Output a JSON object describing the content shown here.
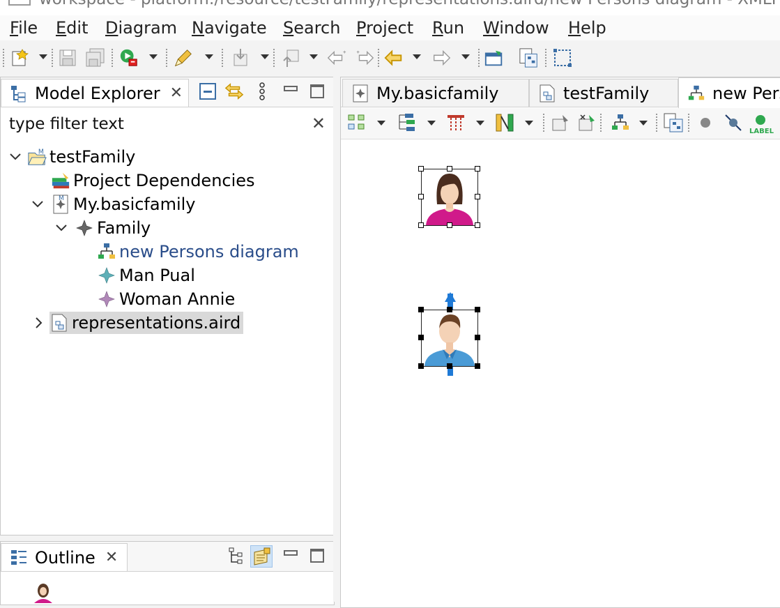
{
  "window": {
    "title": "workspace - platform:/resource/testFamily/representations.aird/new Persons diagram - XMLFT"
  },
  "menubar": {
    "items": [
      {
        "mnemonic": "F",
        "rest": "ile"
      },
      {
        "mnemonic": "E",
        "rest": "dit"
      },
      {
        "mnemonic": "D",
        "rest": "iagram"
      },
      {
        "mnemonic": "N",
        "rest": "avigate"
      },
      {
        "mnemonic": "S",
        "rest": "earch"
      },
      {
        "mnemonic": "P",
        "rest": "roject"
      },
      {
        "mnemonic": "R",
        "rest": "un"
      },
      {
        "mnemonic": "W",
        "rest": "indow"
      },
      {
        "mnemonic": "H",
        "rest": "elp"
      }
    ]
  },
  "toolbar": {
    "icons": [
      "new-icon",
      "save-icon",
      "save-all-icon",
      "run-icon",
      "pen-icon",
      "import-icon",
      "export-icon",
      "back-edit-icon",
      "forward-edit-icon",
      "back-icon",
      "forward-icon",
      "open-perspective-icon",
      "representation-icon",
      "selection-icon"
    ]
  },
  "model_explorer": {
    "tab_label": "Model Explorer",
    "filter": {
      "placeholder": "type filter text",
      "value": "type filter text"
    },
    "tree": [
      {
        "label": "testFamily",
        "icon": "project-folder-icon",
        "expanded": true,
        "level": 0
      },
      {
        "label": "Project Dependencies",
        "icon": "dependencies-icon",
        "level": 1
      },
      {
        "label": "My.basicfamily",
        "icon": "model-file-icon",
        "expanded": true,
        "level": 1
      },
      {
        "label": "Family",
        "icon": "family-icon",
        "expanded": true,
        "level": 2
      },
      {
        "label": "new Persons diagram",
        "icon": "diagram-icon",
        "level": 3
      },
      {
        "label": "Man Pual",
        "icon": "man-icon",
        "level": 3
      },
      {
        "label": "Woman Annie",
        "icon": "woman-icon",
        "level": 3
      },
      {
        "label": "representations.aird",
        "icon": "aird-file-icon",
        "expanded": false,
        "level": 0,
        "selected": true
      }
    ]
  },
  "outline": {
    "tab_label": "Outline"
  },
  "editor": {
    "tabs": [
      {
        "label": "My.basicfamily",
        "icon": "model-file-icon"
      },
      {
        "label": "testFamily",
        "icon": "aird-file-icon"
      },
      {
        "label": "new Pers",
        "icon": "diagram-icon",
        "active": true
      }
    ],
    "diagram_toolbar_label": "LABEL",
    "diagram": {
      "nodes": [
        {
          "name": "woman-node",
          "kind": "woman",
          "selected_primary": false
        },
        {
          "name": "man-node",
          "kind": "man",
          "selected_primary": true
        }
      ],
      "edge_color": "#1f7ad6"
    }
  },
  "colors": {
    "woman_shirt": "#d01a8a",
    "man_shirt": "#4a9bd6",
    "edge": "#1f7ad6",
    "link_text": "#2a4d8a"
  }
}
